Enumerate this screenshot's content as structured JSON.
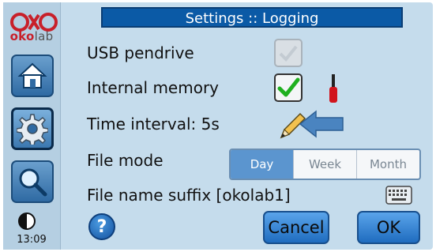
{
  "brand": {
    "logo_prefix": "oko",
    "logo_suffix": "lab"
  },
  "clock": "13:09",
  "title": "Settings :: Logging",
  "rows": {
    "usb_label": "USB pendrive",
    "internal_label": "Internal memory",
    "interval_label": "Time interval: 5s",
    "filemode_label": "File mode",
    "suffix_label": "File name suffix [okolab1]"
  },
  "file_mode": {
    "options": [
      "Day",
      "Week",
      "Month"
    ],
    "selected": "Day"
  },
  "buttons": {
    "help": "?",
    "cancel": "Cancel",
    "ok": "OK"
  },
  "icons": [
    "home-icon",
    "gear-icon",
    "search-icon",
    "contrast-icon",
    "wrench-icon",
    "pencil-icon",
    "keyboard-icon",
    "checkmark-icon",
    "arrow-icon"
  ],
  "colors": {
    "title_bar": "#0b5aa6",
    "accent": "#5b95cf",
    "check": "#1fb01f",
    "logo_red": "#c8202a"
  }
}
